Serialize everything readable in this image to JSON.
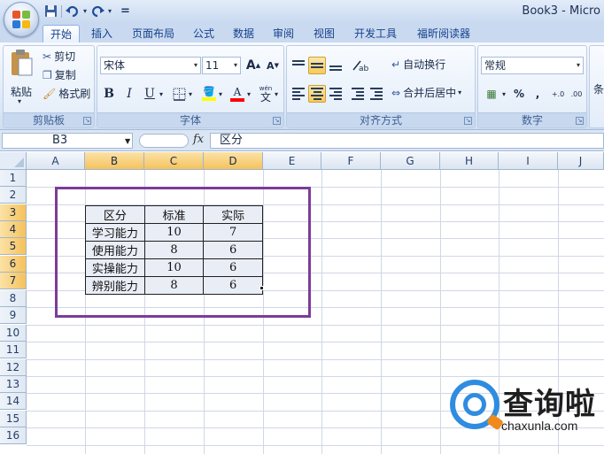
{
  "window": {
    "title": "Book3 - Micro"
  },
  "qat": {
    "save_icon": "save-icon",
    "undo_icon": "undo-icon",
    "redo_icon": "redo-icon",
    "customize": "="
  },
  "tabs": [
    {
      "label": "开始",
      "active": true
    },
    {
      "label": "插入"
    },
    {
      "label": "页面布局"
    },
    {
      "label": "公式"
    },
    {
      "label": "数据"
    },
    {
      "label": "审阅"
    },
    {
      "label": "视图"
    },
    {
      "label": "开发工具"
    },
    {
      "label": "福昕阅读器"
    }
  ],
  "clipboard": {
    "paste_label": "粘贴",
    "cut_label": "剪切",
    "copy_label": "复制",
    "format_painter_label": "格式刷",
    "group_label": "剪贴板"
  },
  "font": {
    "name": "宋体",
    "size": "11",
    "grow": "A",
    "shrink": "A",
    "bold": "B",
    "italic": "I",
    "underline": "U",
    "phonetic": "wén",
    "group_label": "字体",
    "fill_color": "#ffff00",
    "font_color": "#ff0000"
  },
  "alignment": {
    "wrap_label": "自动换行",
    "merge_label": "合并后居中",
    "group_label": "对齐方式"
  },
  "number": {
    "format": "常规",
    "percent": "%",
    "comma": ",",
    "increase_decimal": "+.0",
    "decrease_decimal": ".00",
    "group_label": "数字",
    "partial_label": "条"
  },
  "formula_bar": {
    "name_box": "B3",
    "fx": "fx",
    "content": "区分"
  },
  "columns": [
    "A",
    "B",
    "C",
    "D",
    "E",
    "F",
    "G",
    "H",
    "I",
    "J"
  ],
  "selected_columns": [
    "B",
    "C",
    "D"
  ],
  "rows": [
    "1",
    "2",
    "3",
    "4",
    "5",
    "6",
    "7",
    "8",
    "9",
    "10",
    "11",
    "12",
    "13",
    "14",
    "15",
    "16"
  ],
  "selected_rows": [
    "3",
    "4",
    "5",
    "6",
    "7"
  ],
  "table": {
    "headers": [
      "区分",
      "标准",
      "实际"
    ],
    "rows": [
      [
        "学习能力",
        "10",
        "7"
      ],
      [
        "使用能力",
        "8",
        "6"
      ],
      [
        "实操能力",
        "10",
        "6"
      ],
      [
        "辨别能力",
        "8",
        "6"
      ]
    ]
  },
  "annotation_color": "#7d3c98",
  "watermark": {
    "text": "查询啦",
    "sub": "chaxunla.com"
  }
}
